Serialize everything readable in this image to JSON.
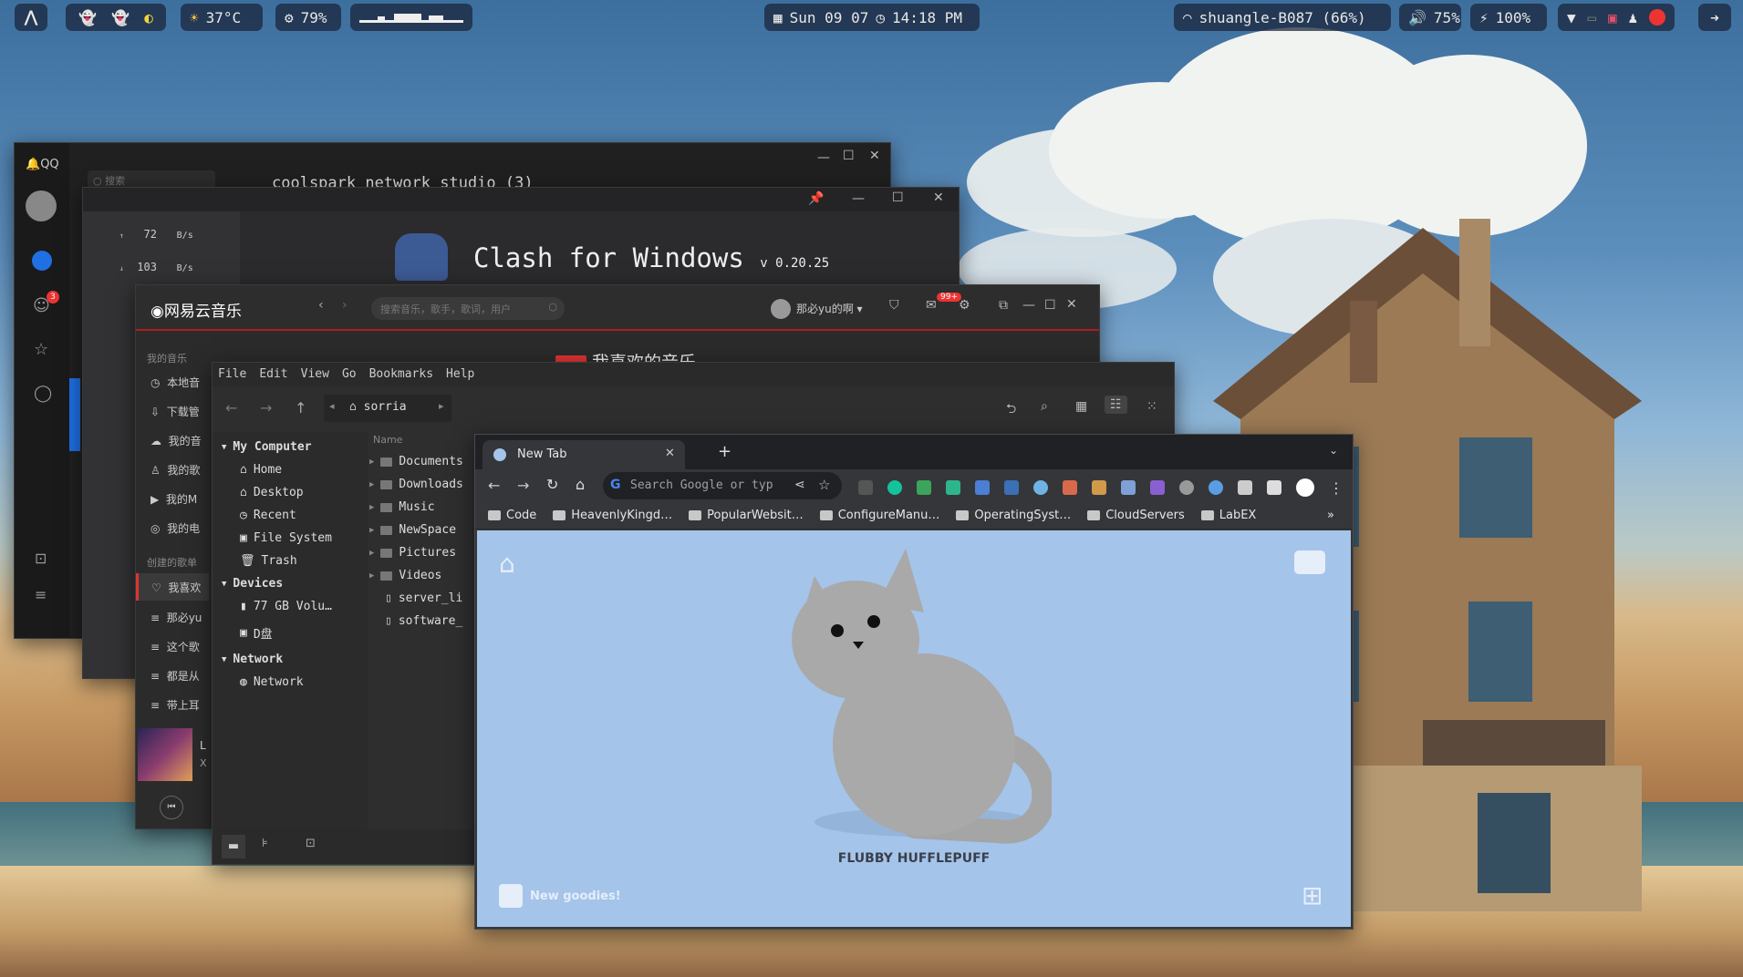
{
  "topbar": {
    "weather": "37°C",
    "brightness": "79%",
    "date": "Sun 09 07",
    "time": "14:18 PM",
    "wifi": "shuangle-B087 (66%)",
    "volume": "75%",
    "battery": "100%"
  },
  "qq": {
    "title": "QQ",
    "search_placeholder": "搜索",
    "chat_title": "coolspark network studio (3)",
    "badge": "3",
    "unread_label": "03"
  },
  "clash": {
    "title": "Clash for Windows",
    "version": "v 0.20.25",
    "upload_value": "72",
    "upload_unit": "B/s",
    "download_value": "103",
    "download_unit": "B/s"
  },
  "netease": {
    "logo": "网易云音乐",
    "search_placeholder": "搜索音乐，歌手，歌词，用户",
    "user": "那必yu的啊",
    "mail_badge": "99+",
    "section_mine": "我的音乐",
    "items": [
      "本地音",
      "下载管",
      "我的音",
      "我的歌",
      "我的M",
      "我的电"
    ],
    "section_created": "创建的歌单",
    "playlists": [
      "我喜欢",
      "那必yu",
      "这个歌",
      "都是从",
      "带上耳"
    ],
    "playlist_header": "我喜欢的音乐",
    "now_playing_line1": "L",
    "now_playing_line2": "X"
  },
  "filemanager": {
    "menu": [
      "File",
      "Edit",
      "View",
      "Go",
      "Bookmarks",
      "Help"
    ],
    "path": "sorria",
    "sections": {
      "my_computer": "My Computer",
      "devices": "Devices",
      "network": "Network"
    },
    "places": [
      "Home",
      "Desktop",
      "Recent",
      "File System",
      "Trash"
    ],
    "devices": [
      "77 GB Volu…",
      "D盘"
    ],
    "network_items": [
      "Network"
    ],
    "column_name": "Name",
    "folders": [
      "Documents",
      "Downloads",
      "Music",
      "NewSpace",
      "Pictures",
      "Videos"
    ],
    "files": [
      "server_li",
      "software_"
    ]
  },
  "chrome": {
    "tab_title": "New Tab",
    "omnibox_placeholder": "Search Google or typ",
    "bookmarks": [
      "Code",
      "HeavenlyKingd…",
      "PopularWebsit…",
      "ConfigureManu…",
      "OperatingSyst…",
      "CloudServers",
      "LabEX"
    ],
    "bookmarks_more": "»",
    "cat_name": "FLUBBY HUFFLEPUFF",
    "new_goodies": "New goodies!",
    "page_bg": "#a4c4ea"
  }
}
